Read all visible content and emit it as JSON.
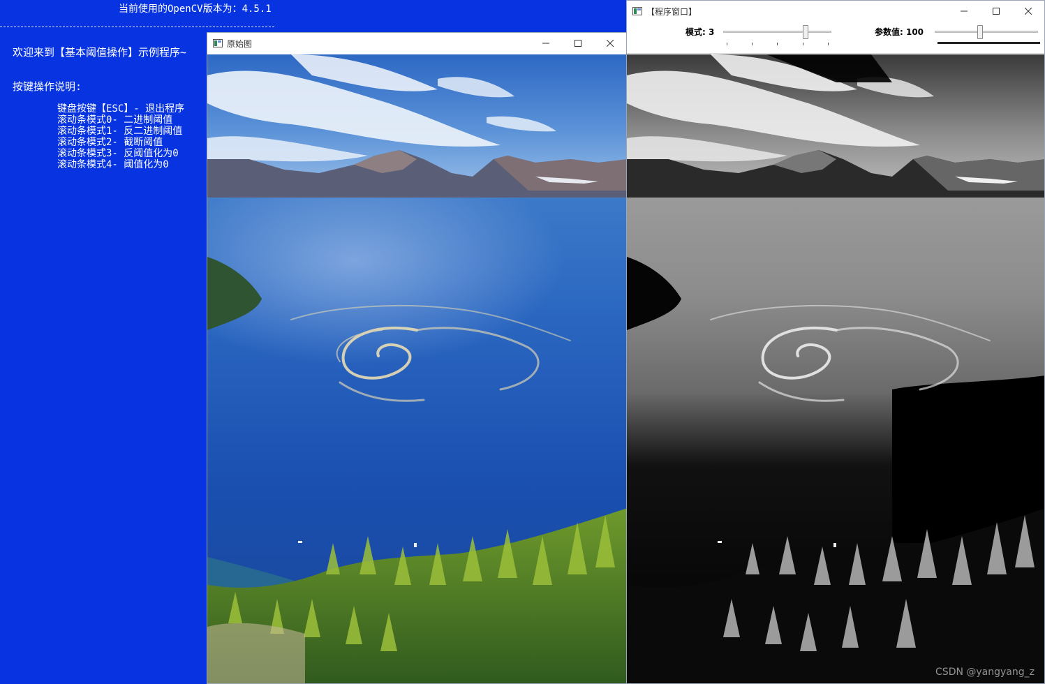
{
  "console": {
    "version_line": "当前使用的OpenCV版本为：4.5.1",
    "separator": "------------------------------------------------------",
    "welcome": "欢迎来到【基本阈值操作】示例程序~",
    "instructions_title": "按键操作说明:",
    "instructions": [
      "键盘按键【ESC】- 退出程序",
      "滚动条模式0- 二进制阈值",
      "滚动条模式1- 反二进制阈值",
      "滚动条模式2- 截断阈值",
      "滚动条模式3- 反阈值化为0",
      "滚动条模式4- 阈值化为0"
    ]
  },
  "original_window": {
    "title": "原始图",
    "image_icon": "lake-whirlpool-photo"
  },
  "program_window": {
    "title": "【程序窗口】",
    "mode_trackbar": {
      "label": "模式: 3",
      "value": 3,
      "max": 4
    },
    "param_trackbar": {
      "label": "参数值: 100",
      "value": 100,
      "max": 255
    },
    "image_icon": "thresholded-grayscale-photo",
    "watermark": "CSDN @yangyang_z"
  },
  "colors": {
    "console_bg": "#0734e0",
    "titlebar_bg": "#ffffff"
  }
}
